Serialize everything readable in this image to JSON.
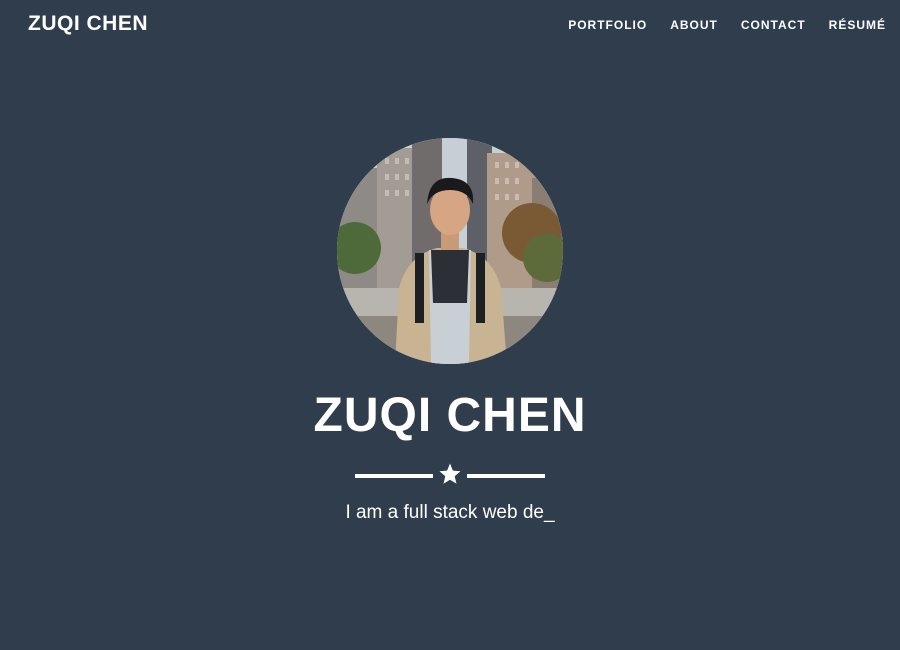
{
  "navbar": {
    "brand": "ZUQI CHEN",
    "links": [
      {
        "label": "PORTFOLIO"
      },
      {
        "label": "ABOUT"
      },
      {
        "label": "CONTACT"
      },
      {
        "label": "RÉSUMÉ"
      }
    ]
  },
  "hero": {
    "name": "ZUQI CHEN",
    "divider_icon": "star-icon",
    "tagline": "I am a full stack web de_"
  },
  "colors": {
    "background": "#2f3d4c",
    "text": "#ffffff"
  }
}
